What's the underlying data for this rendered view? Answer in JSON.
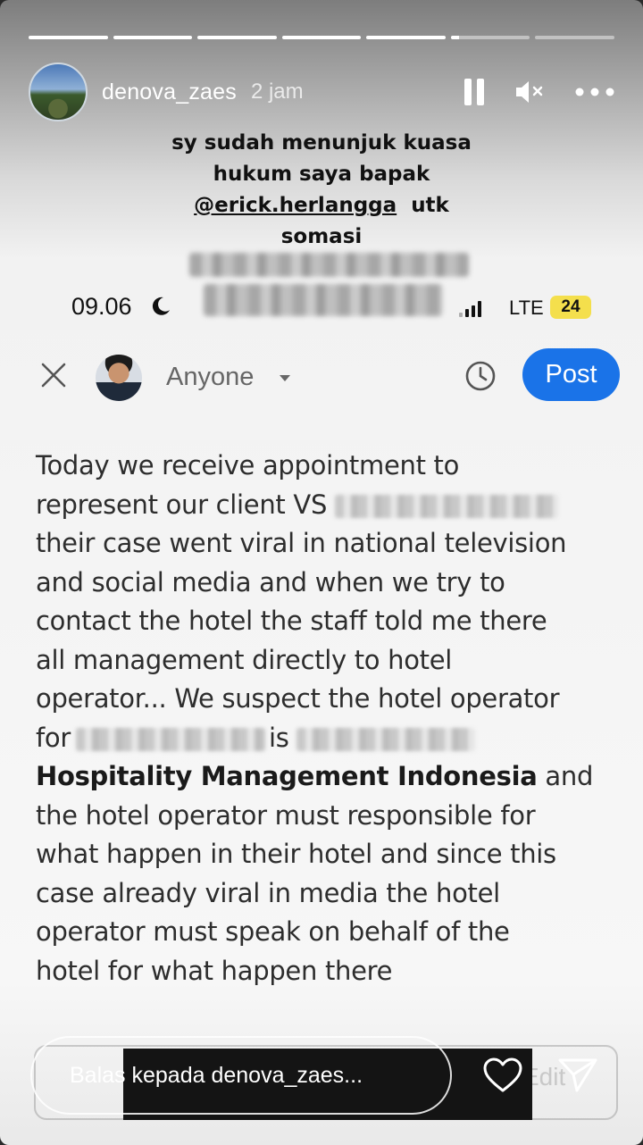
{
  "story": {
    "progress_segments": [
      1,
      1,
      1,
      1,
      1,
      0.1,
      0
    ],
    "username": "denova_zaes",
    "time_ago": "2 jam",
    "header_icons": [
      "pause-icon",
      "mute-icon",
      "more-icon"
    ]
  },
  "caption": {
    "line1": "sy sudah menunjuk kuasa",
    "line2": "hukum saya bapak",
    "mention": "@erick.herlangga",
    "line3_tail": "utk",
    "line4": "somasi"
  },
  "screenshot": {
    "status": {
      "time": "09.06",
      "network": "LTE",
      "battery": "24"
    },
    "composer": {
      "audience": "Anyone",
      "post_label": "Post",
      "lines": [
        "Today we receive appointment to",
        "represent our client VS",
        "their case went viral in national television",
        "and social media and when we try to",
        "contact the hotel the staff told me there",
        "all management directly to hotel",
        "operator... We suspect the hotel operator",
        "for",
        "is",
        "Hospitality Management Indonesia",
        "and",
        "the hotel operator must responsible for",
        "what happen in their hotel and since this",
        "case already viral in media the hotel",
        "operator must speak on behalf of the",
        "hotel for what happen there"
      ]
    }
  },
  "reply": {
    "placeholder": "Balas kepada denova_zaes...",
    "ghost_edit": "Edit"
  },
  "colors": {
    "post_button": "#1a73e8",
    "battery": "#f4df4c"
  }
}
